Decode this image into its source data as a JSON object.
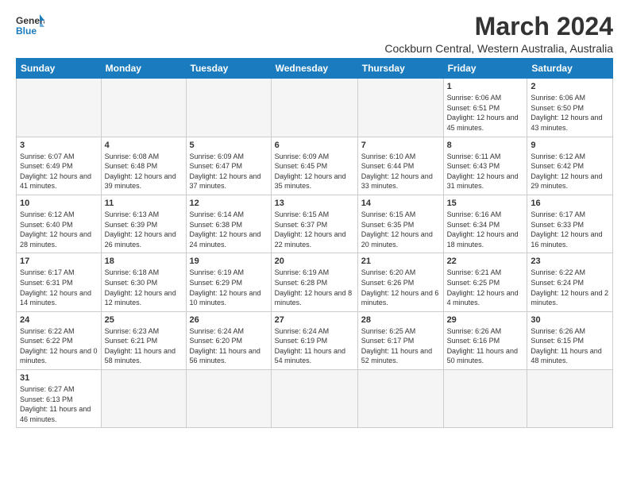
{
  "header": {
    "logo_general": "General",
    "logo_blue": "Blue",
    "month_title": "March 2024",
    "subtitle": "Cockburn Central, Western Australia, Australia"
  },
  "days_of_week": [
    "Sunday",
    "Monday",
    "Tuesday",
    "Wednesday",
    "Thursday",
    "Friday",
    "Saturday"
  ],
  "weeks": [
    [
      {
        "day": "",
        "info": ""
      },
      {
        "day": "",
        "info": ""
      },
      {
        "day": "",
        "info": ""
      },
      {
        "day": "",
        "info": ""
      },
      {
        "day": "",
        "info": ""
      },
      {
        "day": "1",
        "info": "Sunrise: 6:06 AM\nSunset: 6:51 PM\nDaylight: 12 hours and 45 minutes."
      },
      {
        "day": "2",
        "info": "Sunrise: 6:06 AM\nSunset: 6:50 PM\nDaylight: 12 hours and 43 minutes."
      }
    ],
    [
      {
        "day": "3",
        "info": "Sunrise: 6:07 AM\nSunset: 6:49 PM\nDaylight: 12 hours and 41 minutes."
      },
      {
        "day": "4",
        "info": "Sunrise: 6:08 AM\nSunset: 6:48 PM\nDaylight: 12 hours and 39 minutes."
      },
      {
        "day": "5",
        "info": "Sunrise: 6:09 AM\nSunset: 6:47 PM\nDaylight: 12 hours and 37 minutes."
      },
      {
        "day": "6",
        "info": "Sunrise: 6:09 AM\nSunset: 6:45 PM\nDaylight: 12 hours and 35 minutes."
      },
      {
        "day": "7",
        "info": "Sunrise: 6:10 AM\nSunset: 6:44 PM\nDaylight: 12 hours and 33 minutes."
      },
      {
        "day": "8",
        "info": "Sunrise: 6:11 AM\nSunset: 6:43 PM\nDaylight: 12 hours and 31 minutes."
      },
      {
        "day": "9",
        "info": "Sunrise: 6:12 AM\nSunset: 6:42 PM\nDaylight: 12 hours and 29 minutes."
      }
    ],
    [
      {
        "day": "10",
        "info": "Sunrise: 6:12 AM\nSunset: 6:40 PM\nDaylight: 12 hours and 28 minutes."
      },
      {
        "day": "11",
        "info": "Sunrise: 6:13 AM\nSunset: 6:39 PM\nDaylight: 12 hours and 26 minutes."
      },
      {
        "day": "12",
        "info": "Sunrise: 6:14 AM\nSunset: 6:38 PM\nDaylight: 12 hours and 24 minutes."
      },
      {
        "day": "13",
        "info": "Sunrise: 6:15 AM\nSunset: 6:37 PM\nDaylight: 12 hours and 22 minutes."
      },
      {
        "day": "14",
        "info": "Sunrise: 6:15 AM\nSunset: 6:35 PM\nDaylight: 12 hours and 20 minutes."
      },
      {
        "day": "15",
        "info": "Sunrise: 6:16 AM\nSunset: 6:34 PM\nDaylight: 12 hours and 18 minutes."
      },
      {
        "day": "16",
        "info": "Sunrise: 6:17 AM\nSunset: 6:33 PM\nDaylight: 12 hours and 16 minutes."
      }
    ],
    [
      {
        "day": "17",
        "info": "Sunrise: 6:17 AM\nSunset: 6:31 PM\nDaylight: 12 hours and 14 minutes."
      },
      {
        "day": "18",
        "info": "Sunrise: 6:18 AM\nSunset: 6:30 PM\nDaylight: 12 hours and 12 minutes."
      },
      {
        "day": "19",
        "info": "Sunrise: 6:19 AM\nSunset: 6:29 PM\nDaylight: 12 hours and 10 minutes."
      },
      {
        "day": "20",
        "info": "Sunrise: 6:19 AM\nSunset: 6:28 PM\nDaylight: 12 hours and 8 minutes."
      },
      {
        "day": "21",
        "info": "Sunrise: 6:20 AM\nSunset: 6:26 PM\nDaylight: 12 hours and 6 minutes."
      },
      {
        "day": "22",
        "info": "Sunrise: 6:21 AM\nSunset: 6:25 PM\nDaylight: 12 hours and 4 minutes."
      },
      {
        "day": "23",
        "info": "Sunrise: 6:22 AM\nSunset: 6:24 PM\nDaylight: 12 hours and 2 minutes."
      }
    ],
    [
      {
        "day": "24",
        "info": "Sunrise: 6:22 AM\nSunset: 6:22 PM\nDaylight: 12 hours and 0 minutes."
      },
      {
        "day": "25",
        "info": "Sunrise: 6:23 AM\nSunset: 6:21 PM\nDaylight: 11 hours and 58 minutes."
      },
      {
        "day": "26",
        "info": "Sunrise: 6:24 AM\nSunset: 6:20 PM\nDaylight: 11 hours and 56 minutes."
      },
      {
        "day": "27",
        "info": "Sunrise: 6:24 AM\nSunset: 6:19 PM\nDaylight: 11 hours and 54 minutes."
      },
      {
        "day": "28",
        "info": "Sunrise: 6:25 AM\nSunset: 6:17 PM\nDaylight: 11 hours and 52 minutes."
      },
      {
        "day": "29",
        "info": "Sunrise: 6:26 AM\nSunset: 6:16 PM\nDaylight: 11 hours and 50 minutes."
      },
      {
        "day": "30",
        "info": "Sunrise: 6:26 AM\nSunset: 6:15 PM\nDaylight: 11 hours and 48 minutes."
      }
    ],
    [
      {
        "day": "31",
        "info": "Sunrise: 6:27 AM\nSunset: 6:13 PM\nDaylight: 11 hours and 46 minutes."
      },
      {
        "day": "",
        "info": ""
      },
      {
        "day": "",
        "info": ""
      },
      {
        "day": "",
        "info": ""
      },
      {
        "day": "",
        "info": ""
      },
      {
        "day": "",
        "info": ""
      },
      {
        "day": "",
        "info": ""
      }
    ]
  ]
}
